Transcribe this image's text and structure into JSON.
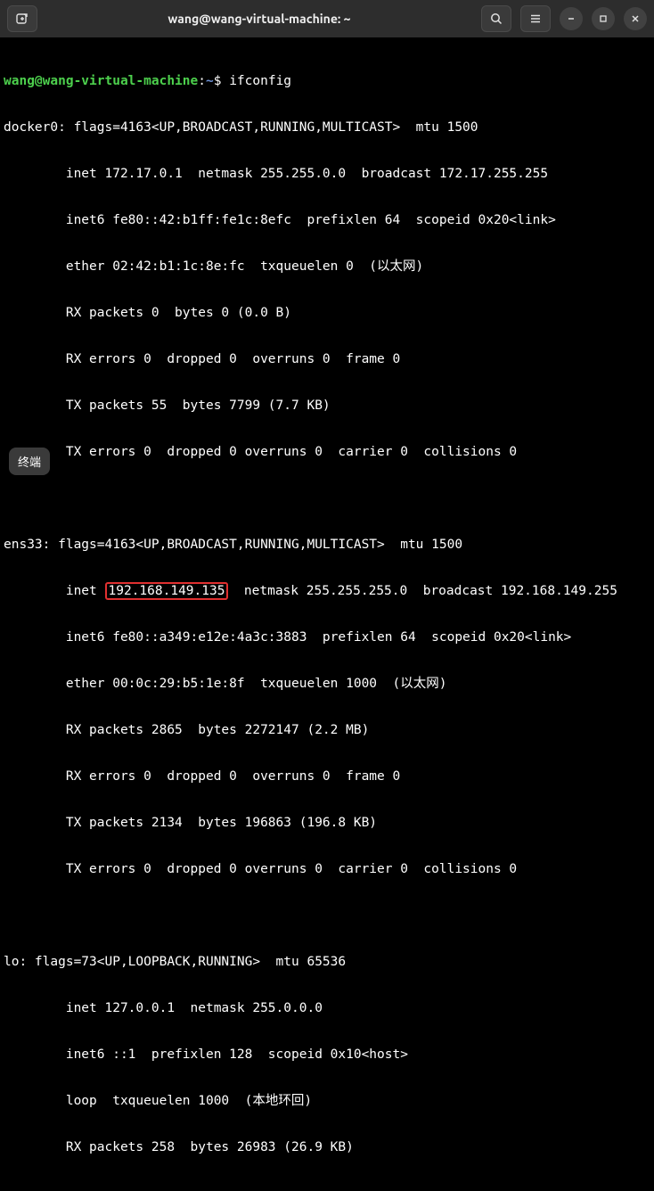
{
  "titlebar": {
    "title": "wang@wang-virtual-machine: ~"
  },
  "prompt": {
    "user_host": "wang@wang-virtual-machine",
    "sep": ":",
    "path": "~",
    "dollar": "$ ",
    "command": "ifconfig"
  },
  "docker0": {
    "l1": "docker0: flags=4163<UP,BROADCAST,RUNNING,MULTICAST>  mtu 1500",
    "l2": "        inet 172.17.0.1  netmask 255.255.0.0  broadcast 172.17.255.255",
    "l3": "        inet6 fe80::42:b1ff:fe1c:8efc  prefixlen 64  scopeid 0x20<link>",
    "l4": "        ether 02:42:b1:1c:8e:fc  txqueuelen 0  (以太网)",
    "l5": "        RX packets 0  bytes 0 (0.0 B)",
    "l6": "        RX errors 0  dropped 0  overruns 0  frame 0",
    "l7": "        TX packets 55  bytes 7799 (7.7 KB)",
    "l8": "        TX errors 0  dropped 0 overruns 0  carrier 0  collisions 0"
  },
  "ens33": {
    "l1": "ens33: flags=4163<UP,BROADCAST,RUNNING,MULTICAST>  mtu 1500",
    "l2a": "        inet ",
    "ip": "192.168.149.135",
    "l2b": "  netmask 255.255.255.0  broadcast 192.168.149.255",
    "l3": "        inet6 fe80::a349:e12e:4a3c:3883  prefixlen 64  scopeid 0x20<link>",
    "l4": "        ether 00:0c:29:b5:1e:8f  txqueuelen 1000  (以太网)",
    "l5": "        RX packets 2865  bytes 2272147 (2.2 MB)",
    "l6": "        RX errors 0  dropped 0  overruns 0  frame 0",
    "l7": "        TX packets 2134  bytes 196863 (196.8 KB)",
    "l8": "        TX errors 0  dropped 0 overruns 0  carrier 0  collisions 0"
  },
  "lo": {
    "l1": "lo: flags=73<UP,LOOPBACK,RUNNING>  mtu 65536",
    "l2": "        inet 127.0.0.1  netmask 255.0.0.0",
    "l3": "        inet6 ::1  prefixlen 128  scopeid 0x10<host>",
    "l4": "        loop  txqueuelen 1000  (本地环回)",
    "l5": "        RX packets 258  bytes 26983 (26.9 KB)"
  },
  "badge": {
    "label": "终端"
  }
}
